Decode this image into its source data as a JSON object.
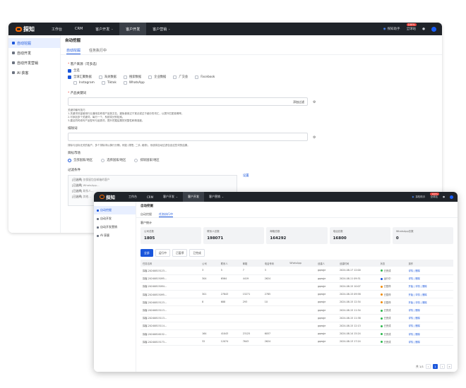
{
  "app": {
    "logo_text": "探知",
    "nav": [
      {
        "label": "工作台",
        "caret": ""
      },
      {
        "label": "CRM",
        "caret": ""
      },
      {
        "label": "客户开发",
        "caret": "⌄"
      },
      {
        "label": "客户开发",
        "caret": ""
      },
      {
        "label": "客户营销",
        "caret": "⌄"
      }
    ],
    "topbar": {
      "assistant": "探知助手",
      "badge": "100%",
      "notice": "全球站",
      "bell_icon": "bell-icon",
      "avatar_icon": "avatar-icon"
    },
    "sidebar": [
      {
        "label": "自动挖掘"
      },
      {
        "label": "自动开发"
      },
      {
        "label": "自动开发营销"
      },
      {
        "label": "AI 获客"
      }
    ]
  },
  "window1": {
    "page_title": "自动挖掘",
    "tabs": [
      "自动挖掘",
      "任务执行中"
    ],
    "source_label": "客户来源（可多选）",
    "sources_row1": [
      {
        "label": "全选",
        "checked": true
      }
    ],
    "sources_row2": [
      {
        "label": "全球汇聚数据",
        "checked": true
      },
      {
        "label": "海关数据",
        "checked": false
      },
      {
        "label": "搜索数据",
        "checked": false
      },
      {
        "label": "企业数据",
        "checked": false
      },
      {
        "label": "广交会",
        "checked": false
      },
      {
        "label": "Facebook",
        "checked": false
      }
    ],
    "sources_row3": [
      {
        "label": "Instagram",
        "checked": false
      },
      {
        "label": "Tiktok",
        "checked": false
      },
      {
        "label": "WhatsApp",
        "checked": false
      }
    ],
    "keyword_label": "产品关键词",
    "keyword_button": "添加过滤",
    "hint_lines": [
      "关键词输写技巧",
      "1.关键词尽量使用行业通用名称或产品英文名，避免使用过于宽泛或过于细分的词汇，以提升匹配准确率。",
      "2.可添加多个关键词，每行一个，系统将分别检索。",
      "3.建议同时填写产品型号与品类词，提升挖掘结果的完整性和精准度。"
    ],
    "exclude_label": "排除词",
    "exclude_hint": "排除与目标无关的客户，多个排除词以换行分隔，例如 (零售, 二手, 维修)，系统将自动过滤包含这些词的结果。",
    "target_label": "目标市场",
    "target_options": [
      {
        "label": "全部国家/地区",
        "on": true
      },
      {
        "label": "选择国家/地区",
        "on": false
      },
      {
        "label": "排除国家/地区",
        "on": false
      }
    ],
    "filter_label": "过滤条件",
    "filter_link": "设置",
    "filter_lines": [
      {
        "prefix": "[已选择]",
        "text": "仅保留包含邮箱的客户"
      },
      {
        "prefix": "[已选择]",
        "text": "WhatsApp..."
      },
      {
        "prefix": "[已选择]",
        "text": "联系人..."
      },
      {
        "prefix": "[已选择]",
        "text": "其他..."
      }
    ]
  },
  "window2": {
    "page_title": "自动挖掘",
    "tabs": [
      "自动挖掘",
      "任务执行中"
    ],
    "stats_title": "客户统计",
    "stats": [
      {
        "label": "公司总数",
        "value": "1805"
      },
      {
        "label": "联系人总数",
        "value": "198071"
      },
      {
        "label": "邮箱总数",
        "value": "164292"
      },
      {
        "label": "电话总数",
        "value": "16800"
      },
      {
        "label": "WhatsApp总数",
        "value": "0"
      }
    ],
    "segments": [
      "全部",
      "运行中",
      "已暂停",
      "已完成"
    ],
    "columns": [
      "任务名称",
      "公司",
      "联系人",
      "邮箱",
      "电话号码",
      "WhatsApp",
      "创建人",
      "创建时间",
      "状态",
      "操作"
    ],
    "rows": [
      [
        "探客-20240815123...",
        "3",
        "5",
        "7",
        "3",
        "",
        "gqeqje",
        "2024-08-17 12:00",
        "已完成",
        "详情 | 删除"
      ],
      [
        "探客-20240815095...",
        "304",
        "6564",
        "4419",
        "2624",
        "",
        "gqeqje",
        "2024-08-11 09:31",
        "运行中",
        "详情 | 删除"
      ],
      [
        "探客-20240815094...",
        "",
        "",
        "",
        "",
        "",
        "gqeqje",
        "2024-08-15 10:07",
        "已暂停",
        "开始 | 详情 | 删除"
      ],
      [
        "探客-20240815095...",
        "301",
        "27843",
        "15271",
        "2785",
        "",
        "gqeqje",
        "2024-08-15 09:58",
        "已暂停",
        "开始 | 详情 | 删除"
      ],
      [
        "探客-20240815123...",
        "8",
        "688",
        "293",
        "10",
        "",
        "gqeqje",
        "2024-08-15 12:34",
        "已暂停",
        "开始 | 详情 | 删除"
      ],
      [
        "探客-20240815113...",
        "",
        "",
        "",
        "",
        "",
        "gqeqje",
        "2024-08-15 11:34",
        "已完成",
        "详情 | 删除"
      ],
      [
        "探客-20240815113...",
        "",
        "",
        "",
        "",
        "",
        "gqeqje",
        "2024-08-15 11:38",
        "已完成",
        "详情 | 删除"
      ],
      [
        "探客-20240815114...",
        "",
        "",
        "",
        "",
        "",
        "gqeqje",
        "2024-08-15 12:13",
        "已完成",
        "详情 | 删除"
      ],
      [
        "探客-20240816152...",
        "164",
        "41043",
        "23125",
        "6057",
        "",
        "gqeqje",
        "2024-08-14 15:24",
        "已完成",
        "详情 | 删除"
      ],
      [
        "探客-20240815173...",
        "32",
        "12074",
        "7643",
        "2624",
        "",
        "gqeqje",
        "2024-08-13 17:24",
        "已完成",
        "详情 | 删除"
      ]
    ],
    "status_colors": {
      "已完成": "#2fb84f",
      "运行中": "#1a56db",
      "已暂停": "#f08a00"
    },
    "pager": {
      "total": "共 1/1",
      "prev": "‹",
      "page": "1",
      "next": "›",
      "next2": "»"
    }
  }
}
